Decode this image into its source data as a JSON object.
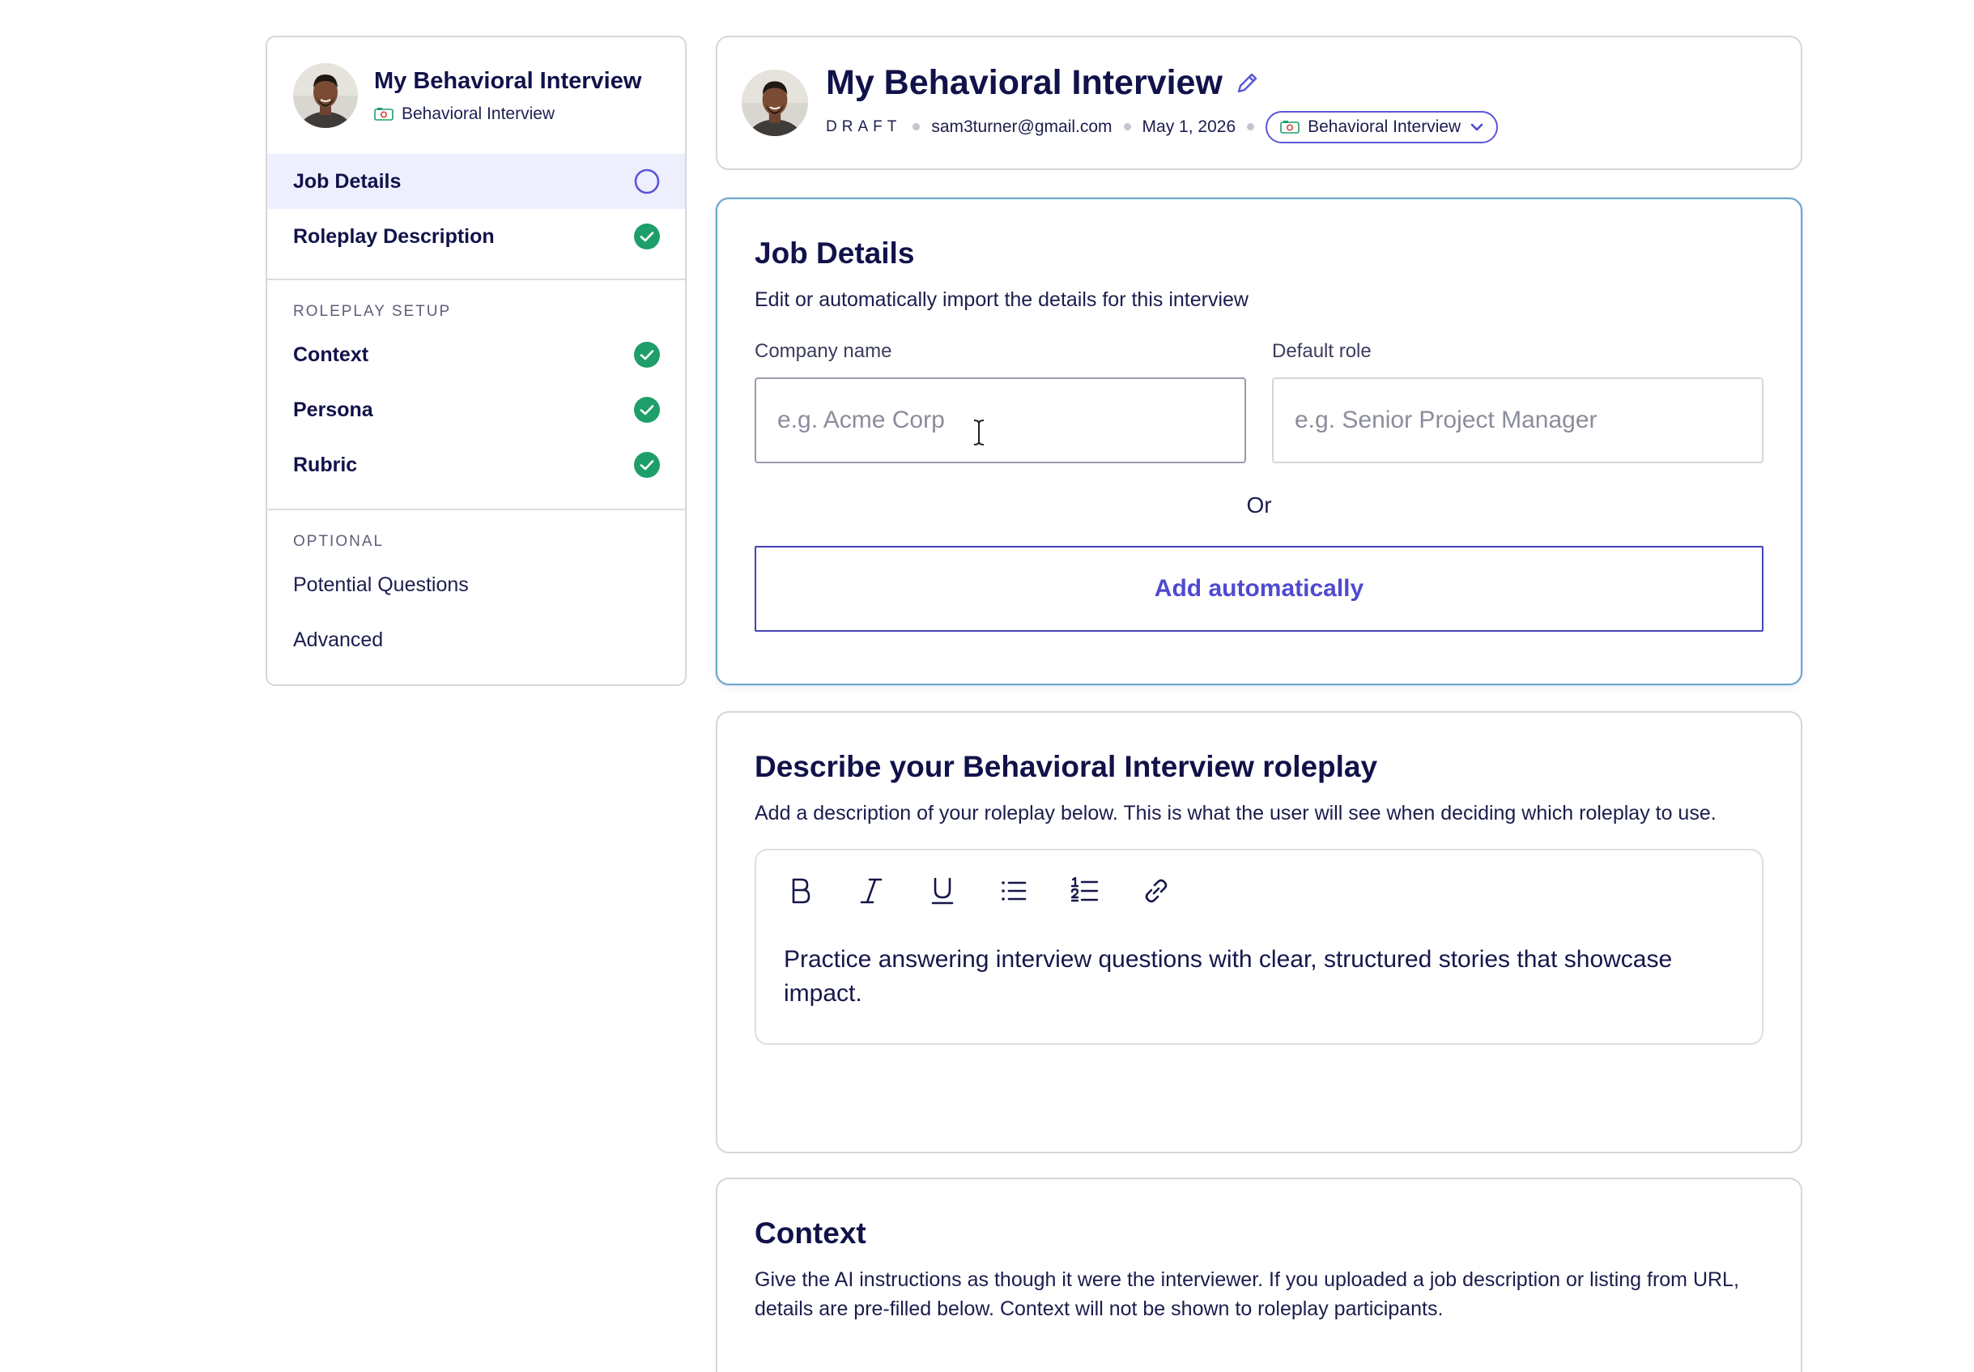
{
  "sidebar": {
    "title": "My Behavioral Interview",
    "type_label": "Behavioral Interview",
    "items": [
      {
        "label": "Job Details",
        "status": "pending"
      },
      {
        "label": "Roleplay Description",
        "status": "complete"
      }
    ],
    "sections": [
      {
        "label": "ROLEPLAY SETUP",
        "items": [
          {
            "label": "Context",
            "status": "complete"
          },
          {
            "label": "Persona",
            "status": "complete"
          },
          {
            "label": "Rubric",
            "status": "complete"
          }
        ]
      },
      {
        "label": "OPTIONAL",
        "items": [
          {
            "label": "Potential Questions"
          },
          {
            "label": "Advanced"
          }
        ]
      }
    ]
  },
  "header": {
    "title": "My Behavioral Interview",
    "status": "DRAFT",
    "email": "sam3turner@gmail.com",
    "date": "May 1, 2026",
    "type_label": "Behavioral Interview"
  },
  "job_details": {
    "title": "Job Details",
    "description": "Edit or automatically import the details for this interview",
    "company": {
      "label": "Company name",
      "placeholder": "e.g. Acme Corp",
      "value": ""
    },
    "role": {
      "label": "Default role",
      "placeholder": "e.g. Senior Project Manager",
      "value": ""
    },
    "or_label": "Or",
    "add_button": "Add automatically"
  },
  "description_card": {
    "title": "Describe your Behavioral Interview roleplay",
    "description": "Add a description of your roleplay below. This is what the user will see when deciding which roleplay to use.",
    "toolbar": [
      "bold-icon",
      "italic-icon",
      "underline-icon",
      "bullet-list-icon",
      "numbered-list-icon",
      "link-icon"
    ],
    "text": "Practice answering interview questions with clear, structured stories that showcase impact."
  },
  "context_card": {
    "title": "Context",
    "description": "Give the AI instructions as though it were the interviewer. If you uploaded a job description or listing from URL, details are pre-filled below. Context will not be shown to roleplay participants."
  },
  "colors": {
    "accent": "#4f4ad0",
    "success": "#1e9e6a",
    "active_bg": "#eeeffd",
    "heading": "#11124a"
  }
}
